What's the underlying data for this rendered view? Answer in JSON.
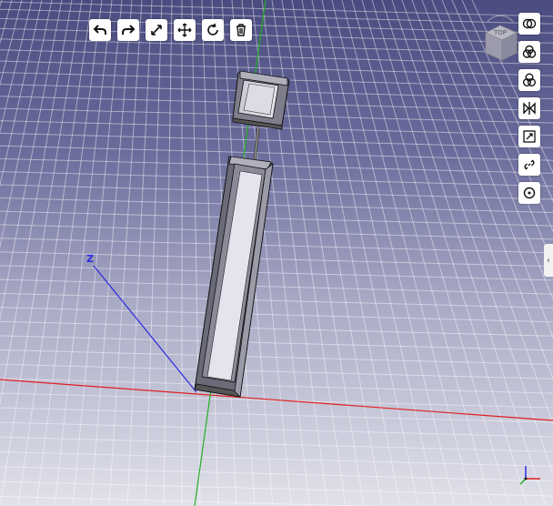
{
  "toolbar": {
    "buttons": [
      {
        "name": "undo-button",
        "icon": "undo-icon"
      },
      {
        "name": "redo-button",
        "icon": "redo-icon"
      },
      {
        "name": "measure-button",
        "icon": "measure-icon"
      },
      {
        "name": "move-button",
        "icon": "move-icon"
      },
      {
        "name": "rotate-button",
        "icon": "rotate-icon"
      },
      {
        "name": "delete-button",
        "icon": "trash-icon"
      }
    ]
  },
  "right_toolbar": {
    "buttons": [
      {
        "name": "union-button",
        "icon": "union-icon"
      },
      {
        "name": "subtract-button",
        "icon": "subtract-icon"
      },
      {
        "name": "intersect-button",
        "icon": "intersect-icon"
      },
      {
        "name": "mirror-button",
        "icon": "mirror-icon"
      },
      {
        "name": "scale-button",
        "icon": "scale-icon"
      },
      {
        "name": "link-button",
        "icon": "link-icon"
      },
      {
        "name": "center-button",
        "icon": "target-icon"
      }
    ]
  },
  "nav_cube": {
    "face_label": "TOP"
  },
  "side_tab": {
    "glyph": "‹"
  },
  "axes": {
    "z_label": "Z",
    "x_color": "#e02020",
    "y_color": "#20b020",
    "z_color": "#2a2ae0"
  },
  "background": {
    "top": "#4a4b7f",
    "bottom": "#e1e1ea",
    "grid": "#ffffff"
  }
}
